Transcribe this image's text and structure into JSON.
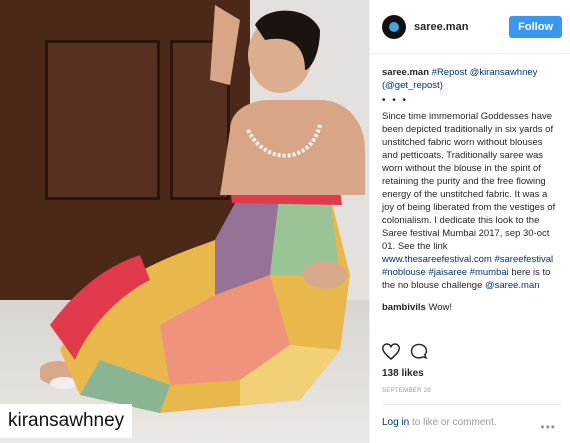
{
  "photo": {
    "watermark": "kiransawhney"
  },
  "post": {
    "username": "saree.man",
    "follow_label": "Follow",
    "caption_user": "saree.man",
    "caption_tags": "#Repost @kiransawhney (@get_repost)",
    "dots": "• • •",
    "caption_text_1": "Since time immemorial Goddesses have been depicted traditionally in six yards of unstitched fabric worn without blouses and petticoats. Traditionally saree was worn without the blouse in the spirit of retaining the purity and the free flowing energy of the unstitched fabric. It was a joy of being liberated from the vestiges of colonialism. I dedicate this look to the Saree festival Mumbai 2017, sep 30-oct 01. See the link ",
    "caption_link": "www.thesareefestival.com",
    "caption_hashtags_1": " #sareefestival #noblouse #jaisaree #mumbai",
    "caption_text_2": " here is to the no blouse challenge ",
    "caption_mention": "@saree.man",
    "comment_user": "bambivils",
    "comment_text": "Wow!",
    "likes": "138 likes",
    "date": "SEPTEMBER 28",
    "login_link": "Log in",
    "login_text": " to like or comment.",
    "more_icon": "•••"
  },
  "icons": {
    "like": "heart-icon",
    "comment": "comment-icon",
    "more": "more-icon"
  },
  "colors": {
    "follow": "#3897f0",
    "link": "#003569"
  }
}
